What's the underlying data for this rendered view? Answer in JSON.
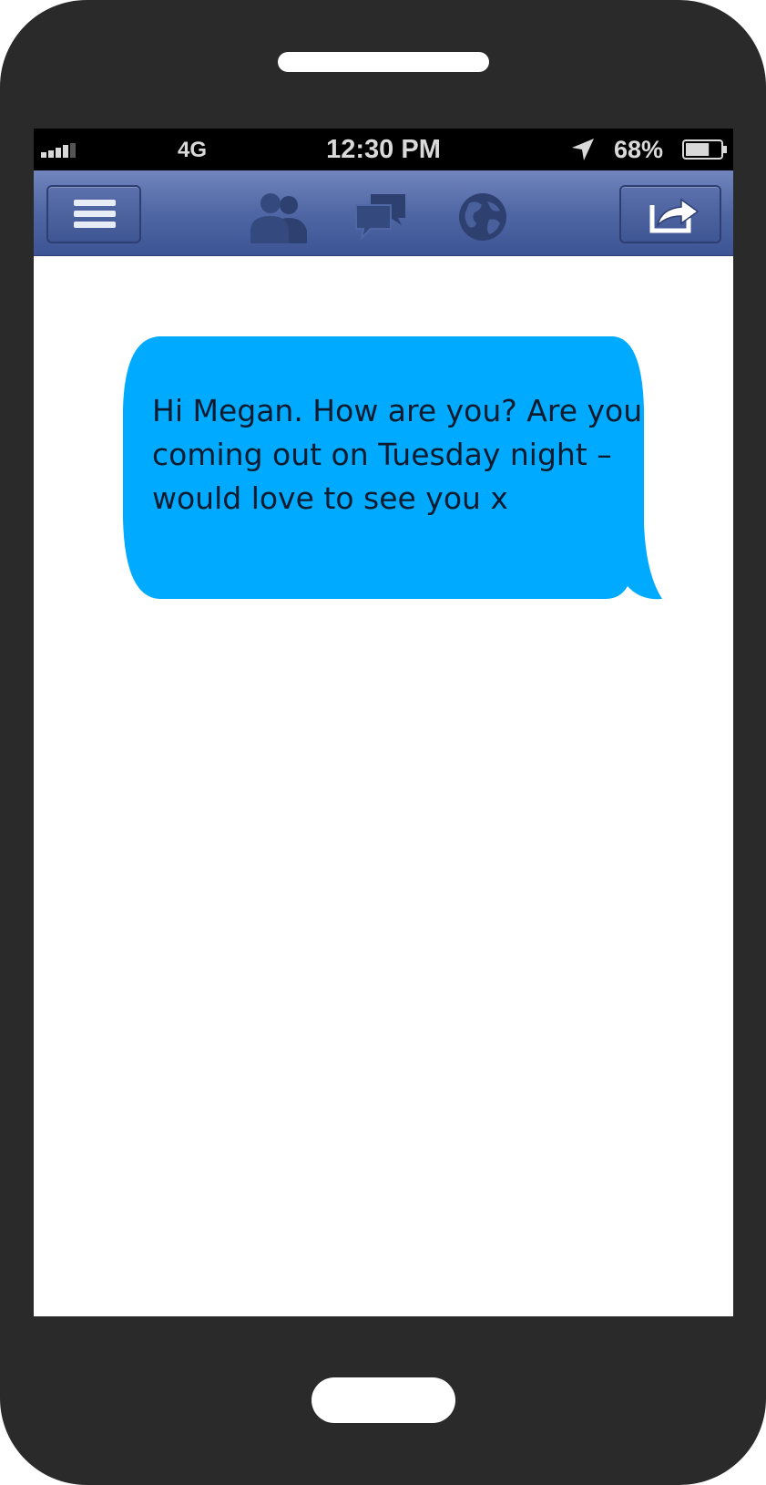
{
  "status_bar": {
    "network": "4G",
    "time": "12:30 PM",
    "battery_percent": "68%",
    "battery_level": 0.68,
    "icons": [
      "signal-strength-icon",
      "location-arrow-icon",
      "battery-icon"
    ]
  },
  "nav_bar": {
    "icons": [
      "menu-icon",
      "friends-icon",
      "messages-icon",
      "globe-icon",
      "share-icon"
    ],
    "colors": {
      "bar_top": "#7185bd",
      "bar_bottom": "#3d5494",
      "icon_dark": "#2d4070"
    }
  },
  "message": {
    "text": "Hi Megan. How are you? Are you coming out on Tuesday night – would love to see you x",
    "bubble_color": "#00aaff"
  },
  "device": {
    "body_color": "#2a2a2a"
  }
}
